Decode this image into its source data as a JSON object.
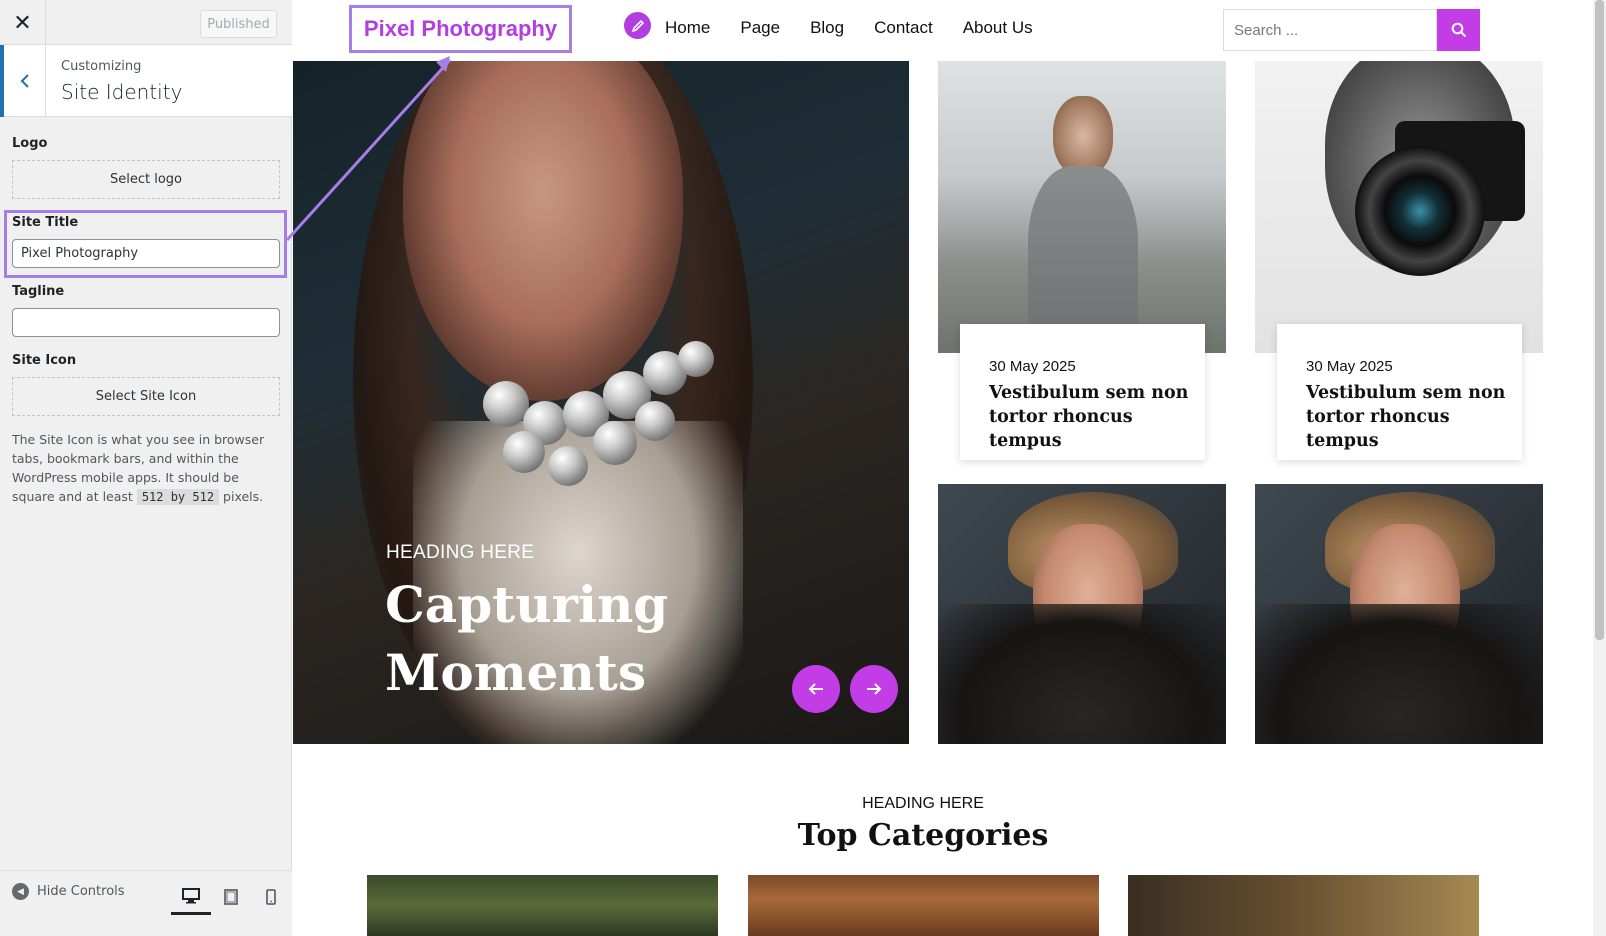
{
  "customizer": {
    "close_icon": "close-icon",
    "publish_button": "Published",
    "customizing_label": "Customizing",
    "section_title": "Site Identity",
    "logo": {
      "label": "Logo",
      "button": "Select logo"
    },
    "site_title": {
      "label": "Site Title",
      "value": "Pixel Photography"
    },
    "tagline": {
      "label": "Tagline",
      "value": ""
    },
    "site_icon": {
      "label": "Site Icon",
      "button": "Select Site Icon",
      "description_pre": "The Site Icon is what you see in browser tabs, bookmark bars, and within the WordPress mobile apps. It should be square and at least",
      "code_a": "512 by 512",
      "description_post": "pixels."
    },
    "footer": {
      "hide_controls": "Hide Controls"
    },
    "accent_color": "#2271b1",
    "highlight_color": "#a77de6"
  },
  "site": {
    "title": "Pixel Photography",
    "nav": [
      "Home",
      "Page",
      "Blog",
      "Contact",
      "About Us"
    ],
    "search_placeholder": "Search ...",
    "brand_color": "#c33de6",
    "hero": {
      "subheading": "HEADING HERE",
      "heading": "Capturing Moments"
    },
    "posts": [
      {
        "date": "30 May 2025",
        "title": "Vestibulum sem non tortor rhoncus tempus"
      },
      {
        "date": "30 May 2025",
        "title": "Vestibulum sem non tortor rhoncus tempus"
      }
    ],
    "categories": {
      "subheading": "HEADING HERE",
      "title": "Top Categories"
    }
  }
}
